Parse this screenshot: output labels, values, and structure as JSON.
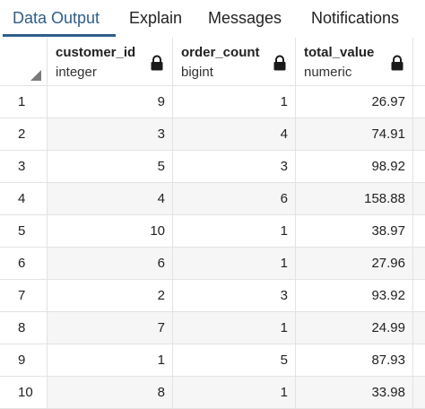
{
  "tabs": [
    {
      "label": "Data Output",
      "active": true
    },
    {
      "label": "Explain",
      "active": false
    },
    {
      "label": "Messages",
      "active": false
    },
    {
      "label": "Notifications",
      "active": false
    }
  ],
  "columns": [
    {
      "name": "customer_id",
      "type": "integer"
    },
    {
      "name": "order_count",
      "type": "bigint"
    },
    {
      "name": "total_value",
      "type": "numeric"
    }
  ],
  "rows": [
    {
      "n": "1",
      "customer_id": "9",
      "order_count": "1",
      "total_value": "26.97"
    },
    {
      "n": "2",
      "customer_id": "3",
      "order_count": "4",
      "total_value": "74.91"
    },
    {
      "n": "3",
      "customer_id": "5",
      "order_count": "3",
      "total_value": "98.92"
    },
    {
      "n": "4",
      "customer_id": "4",
      "order_count": "6",
      "total_value": "158.88"
    },
    {
      "n": "5",
      "customer_id": "10",
      "order_count": "1",
      "total_value": "38.97"
    },
    {
      "n": "6",
      "customer_id": "6",
      "order_count": "1",
      "total_value": "27.96"
    },
    {
      "n": "7",
      "customer_id": "2",
      "order_count": "3",
      "total_value": "93.92"
    },
    {
      "n": "8",
      "customer_id": "7",
      "order_count": "1",
      "total_value": "24.99"
    },
    {
      "n": "9",
      "customer_id": "1",
      "order_count": "5",
      "total_value": "87.93"
    },
    {
      "n": "10",
      "customer_id": "8",
      "order_count": "1",
      "total_value": "33.98"
    }
  ],
  "colors": {
    "accent": "#2f5d8a",
    "row_alt": "#f6f6f6",
    "border": "#e3e3e3"
  },
  "icons": {
    "column_lock": "lock-icon",
    "corner": "select-all-triangle-icon"
  }
}
